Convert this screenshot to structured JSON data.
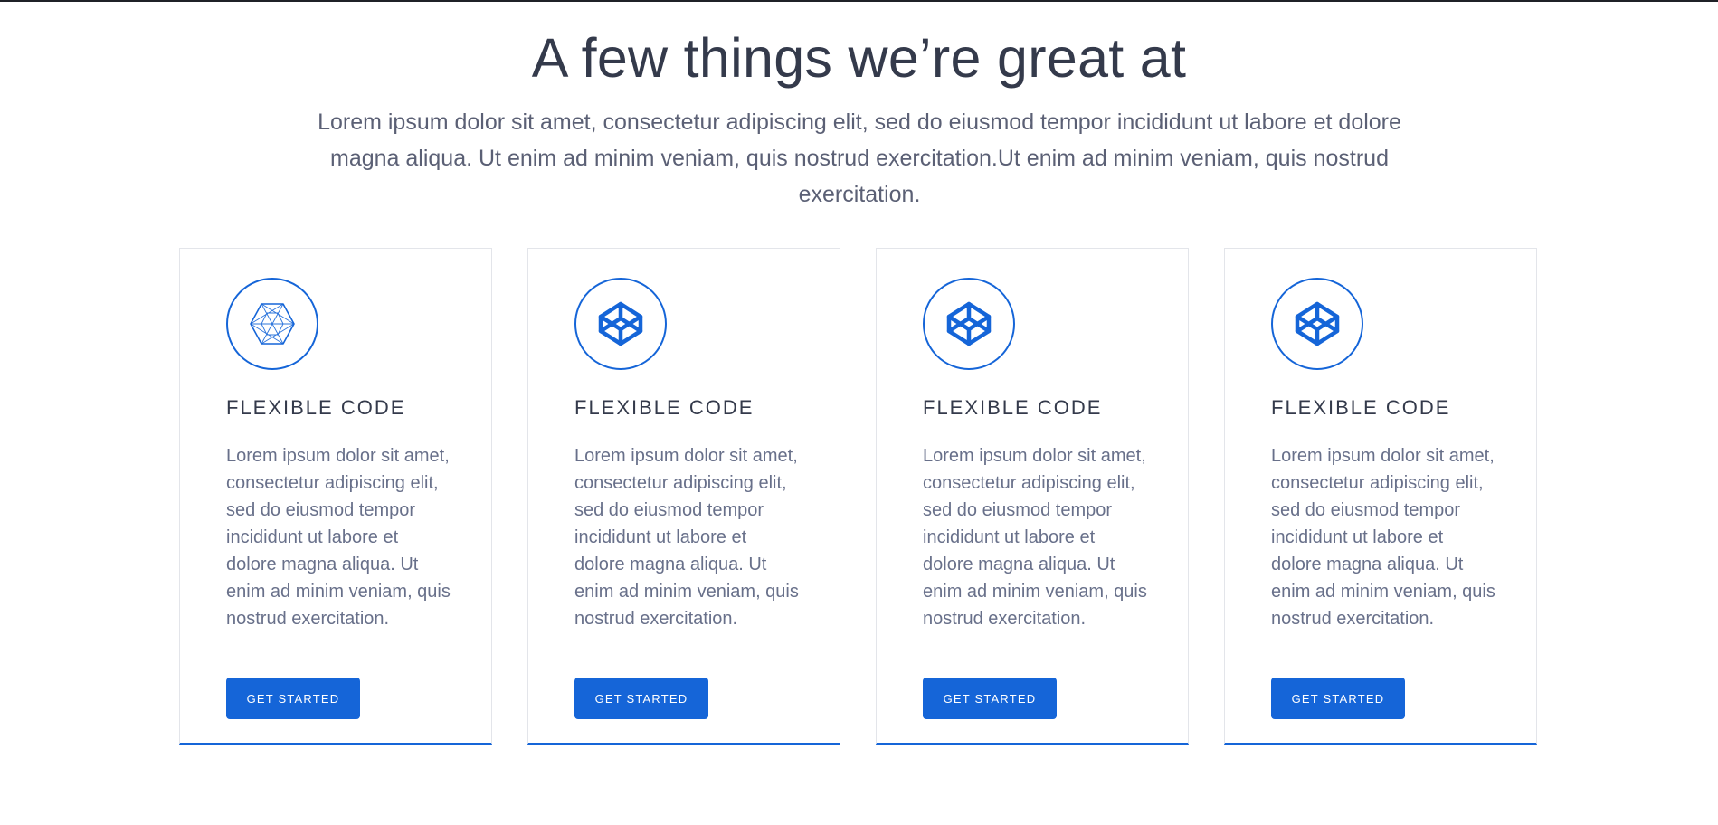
{
  "section": {
    "heading": "A few things we’re great at",
    "intro": "Lorem ipsum dolor sit amet, consectetur adipiscing elit, sed do eiusmod tempor incididunt ut labore et dolore magna aliqua. Ut enim ad minim veniam, quis nostrud exercitation.Ut enim ad minim veniam, quis nostrud exercitation."
  },
  "cards": [
    {
      "icon": "wireframe-hexagon-icon",
      "title": "FLEXIBLE CODE",
      "text": "Lorem ipsum dolor sit amet, consectetur adipiscing elit, sed do eiusmod tempor incididunt ut labore et dolore magna aliqua. Ut enim ad minim veniam, quis nostrud exercitation.",
      "button_label": "GET STARTED"
    },
    {
      "icon": "codepen-cube-icon",
      "title": "FLEXIBLE CODE",
      "text": "Lorem ipsum dolor sit amet, consectetur adipiscing elit, sed do eiusmod tempor incididunt ut labore et dolore magna aliqua. Ut enim ad minim veniam, quis nostrud exercitation.",
      "button_label": "GET STARTED"
    },
    {
      "icon": "codepen-cube-icon",
      "title": "FLEXIBLE CODE",
      "text": "Lorem ipsum dolor sit amet, consectetur adipiscing elit, sed do eiusmod tempor incididunt ut labore et dolore magna aliqua. Ut enim ad minim veniam, quis nostrud exercitation.",
      "button_label": "GET STARTED"
    },
    {
      "icon": "codepen-cube-icon",
      "title": "FLEXIBLE CODE",
      "text": "Lorem ipsum dolor sit amet, consectetur adipiscing elit, sed do eiusmod tempor incididunt ut labore et dolore magna aliqua. Ut enim ad minim veniam, quis nostrud exercitation.",
      "button_label": "GET STARTED"
    }
  ],
  "colors": {
    "accent": "#1565d8",
    "heading": "#343a4b",
    "body_text": "#68708a",
    "card_border": "#e3e5ea"
  }
}
